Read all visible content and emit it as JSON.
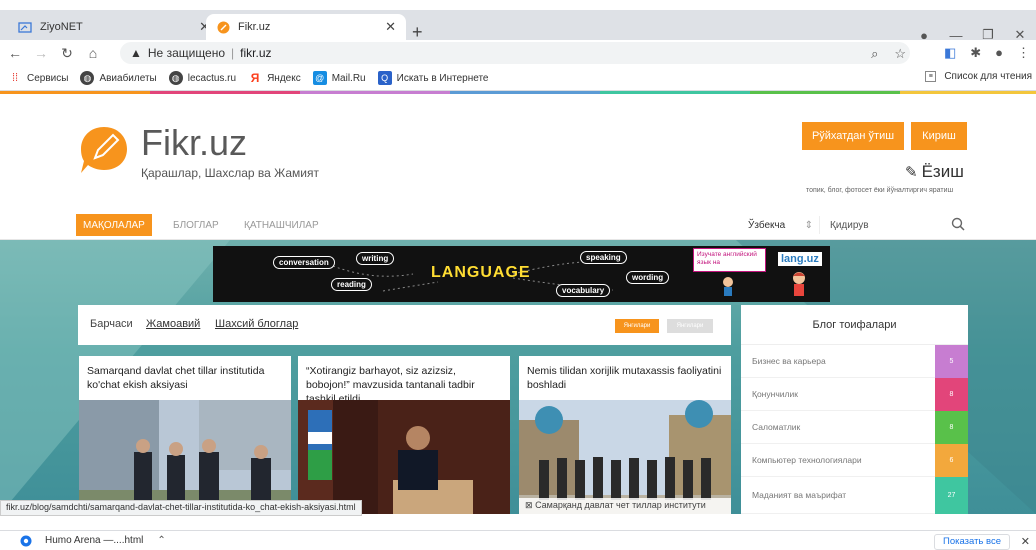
{
  "browser": {
    "tabs": [
      {
        "label": "ZiyoNET",
        "icon": "folder-icon",
        "active": false
      },
      {
        "label": "Fikr.uz",
        "icon": "fikr-favicon",
        "active": true
      }
    ],
    "address": {
      "security_label": "Не защищено",
      "host": "fikr.uz"
    },
    "bookmarks": [
      {
        "label": "Сервисы",
        "icon": "apps-grid-icon"
      },
      {
        "label": "Авиабилеты",
        "icon": "globe-icon"
      },
      {
        "label": "lecactus.ru",
        "icon": "globe-icon"
      },
      {
        "label": "Яндекс",
        "icon": "yandex-icon"
      },
      {
        "label": "Mail.Ru",
        "icon": "mailru-icon"
      },
      {
        "label": "Искать в Интернете",
        "icon": "search-icon"
      }
    ],
    "reading_list": "Список для чтения",
    "status_url": "fikr.uz/blog/samdchti/samarqand-davlat-chet-tillar-institutida-ko_chat-ekish-aksiyasi.html",
    "download": {
      "file": "Humo Arena —....html",
      "show_all": "Показать все"
    }
  },
  "site": {
    "title": "Fikr.uz",
    "subtitle": "Қарашлар, Шахслар ва Жамият",
    "register_label": "Рўйхатдан ўтиш",
    "login_label": "Кириш",
    "write_label": "Ёзиш",
    "write_sub": "топик, блог, фотосет ёки йўналтиргич яратиш",
    "menu": [
      {
        "label": "МАҚОЛАЛАР",
        "active": true
      },
      {
        "label": "БЛОГЛАР",
        "active": false
      },
      {
        "label": "ҚАТНАШЧИЛАР",
        "active": false
      }
    ],
    "language": "Ўзбекча",
    "search_placeholder": "Қидирув",
    "banner": {
      "pills": [
        "conversation",
        "writing",
        "reading",
        "speaking",
        "wording",
        "vocabulary"
      ],
      "headline": "LANGUAGE",
      "ad_text": "Изучате английский язык на",
      "brand": "lang.uz"
    },
    "panel": {
      "tabs": [
        "Барчаси",
        "Жамоавий",
        "Шахсий блоглар"
      ],
      "selected_tab": 1,
      "btn_new": "Янгилари",
      "btn_old": "Янгилари"
    },
    "articles": [
      {
        "title": "Samarqand davlat chet tillar institutida ko'chat ekish aksiyasi",
        "caption": ""
      },
      {
        "title": "“Xotirangiz barhayot, siz azizsiz, bobojon!” mavzusida tantanali tadbir tashkil etildi",
        "caption": ""
      },
      {
        "title": "Nemis tilidan xorijlik mutaxassis faoliyatini boshladi",
        "caption": "Самарқанд давлат чет тиллар институти"
      }
    ],
    "blog_categories": {
      "title": "Блог тоифалари",
      "items": [
        {
          "label": "Бизнес ва карьера",
          "count": "5",
          "color": "#c77dd1"
        },
        {
          "label": "Қонунчилик",
          "count": "8",
          "color": "#e2457a"
        },
        {
          "label": "Саломатлик",
          "count": "8",
          "color": "#59c14a"
        },
        {
          "label": "Компьютер технологиялари",
          "count": "6",
          "color": "#f3a83c"
        },
        {
          "label": "Маданият ва маърифат",
          "count": "27",
          "color": "#3fc6a0"
        }
      ]
    }
  },
  "colors": {
    "accent": "#f7941d"
  }
}
